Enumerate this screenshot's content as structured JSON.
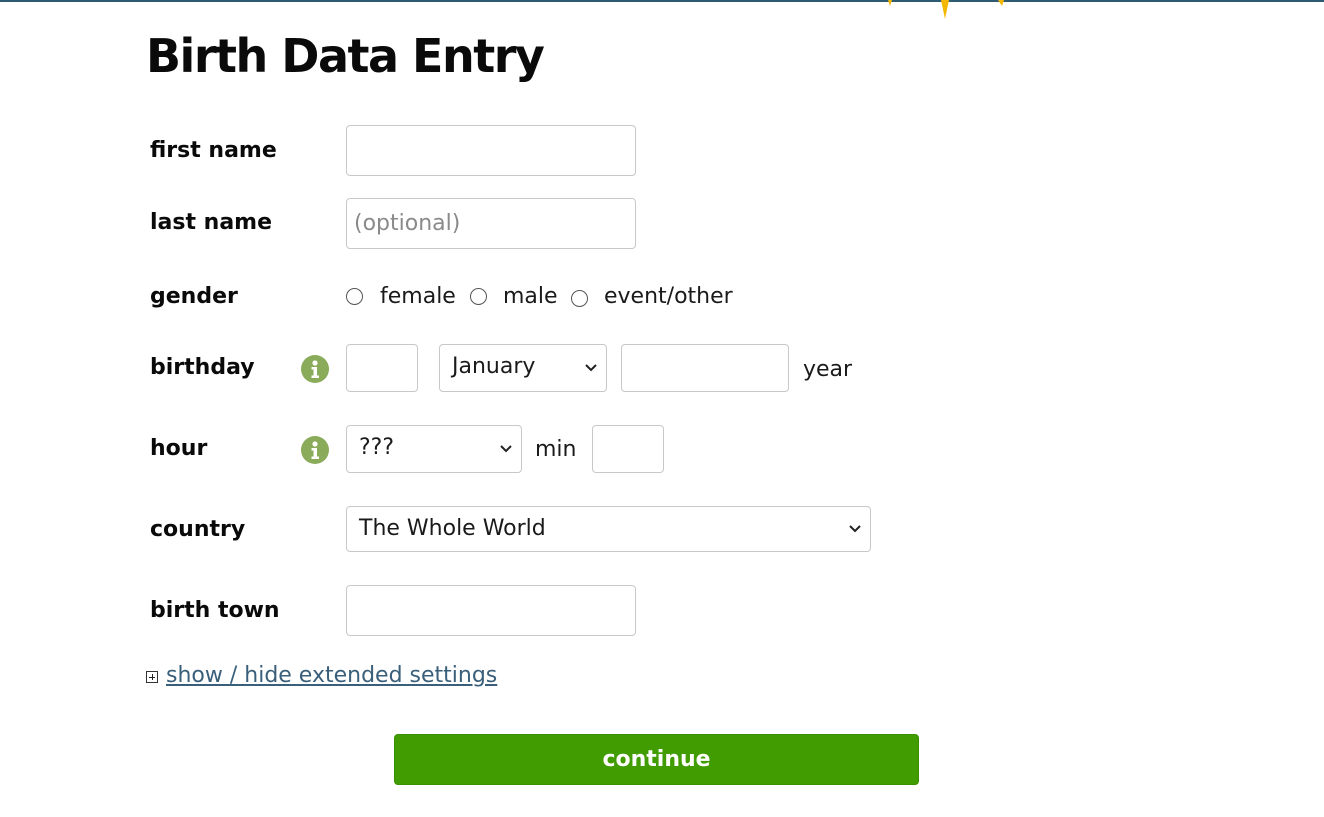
{
  "page": {
    "title": "Birth Data Entry"
  },
  "form": {
    "first_name": {
      "label": "first name",
      "value": "",
      "placeholder": ""
    },
    "last_name": {
      "label": "last name",
      "value": "",
      "placeholder": "(optional)"
    },
    "gender": {
      "label": "gender",
      "options": [
        "female",
        "male",
        "event/other"
      ],
      "selected": null
    },
    "birthday": {
      "label": "birthday",
      "day": "",
      "month": "January",
      "year": "",
      "year_suffix": "year"
    },
    "hour": {
      "label": "hour",
      "hour_value": "???",
      "min_label": "min",
      "min_value": ""
    },
    "country": {
      "label": "country",
      "value": "The Whole World"
    },
    "birth_town": {
      "label": "birth town",
      "value": ""
    }
  },
  "extended_settings_link": "show / hide extended settings",
  "submit_label": "continue",
  "colors": {
    "accent_green": "#409c00",
    "info_icon": "#8aab5a",
    "link": "#3a5f7a",
    "top_line": "#2f5a73",
    "deco_sun": "#f5b800"
  },
  "icons": {
    "info": "info-icon",
    "chevron": "chevron-down-icon",
    "expand": "plus-box-icon"
  }
}
